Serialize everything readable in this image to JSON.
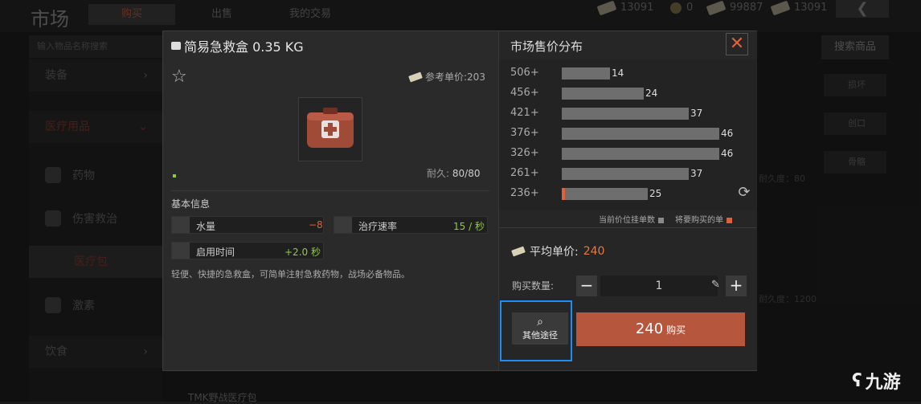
{
  "background": {
    "title": "市场",
    "tabs": [
      "购买",
      "出售",
      "我的交易"
    ],
    "currency": [
      "13091",
      "0",
      "99887",
      "13091"
    ],
    "search_placeholder": "输入物品名称搜索",
    "search_button": "搜索商品",
    "categories": [
      {
        "label": "装备",
        "chevron": "›"
      },
      {
        "label": "医疗用品",
        "chevron": "⌄"
      }
    ],
    "subcategories": [
      "药物",
      "伤害救治",
      "医疗包",
      "激素"
    ],
    "food": {
      "label": "饮食",
      "chevron": "›"
    },
    "right_items": [
      "损坏",
      "创口",
      "骨骼"
    ],
    "bg_texts": [
      "耐久度：80",
      "耐久度：1200",
      "TMK野战医疗包"
    ]
  },
  "modal": {
    "item": {
      "name": "简易急救盒 0.35 KG",
      "ref_price_label": "参考单价:203",
      "durability_label": "耐久:",
      "durability_value": "80/80",
      "basic_info_title": "基本信息",
      "stats": [
        {
          "label": "水量",
          "value": "−8",
          "color": "#e0603a"
        },
        {
          "label": "治疗速率",
          "value": "15 / 秒",
          "color": "#8fcc3a"
        },
        {
          "label": "启用时间",
          "value": "+2.0 秒",
          "color": "#8fcc3a"
        }
      ],
      "description": "轻便、快捷的急救盒，可简单注射急救药物，战场必备物品。"
    },
    "market": {
      "title": "市场售价分布",
      "close": "✕",
      "distribution": [
        {
          "price": "506+",
          "count": 14
        },
        {
          "price": "456+",
          "count": 24
        },
        {
          "price": "421+",
          "count": 37
        },
        {
          "price": "376+",
          "count": 46
        },
        {
          "price": "326+",
          "count": 46
        },
        {
          "price": "261+",
          "count": 37
        },
        {
          "price": "236+",
          "count": 25
        }
      ],
      "legend_current": "当前价位挂单数",
      "legend_buy": "将要购买的单",
      "legend_current_color": "#8a8a8a",
      "legend_buy_color": "#e0603a",
      "avg_label": "平均单价:",
      "avg_value": "240",
      "qty_label": "购买数量:",
      "qty_value": "1",
      "minus": "−",
      "plus": "+",
      "other_label": "其他途径",
      "buy_price": "240",
      "buy_label": "购买"
    }
  },
  "watermark": "九游"
}
